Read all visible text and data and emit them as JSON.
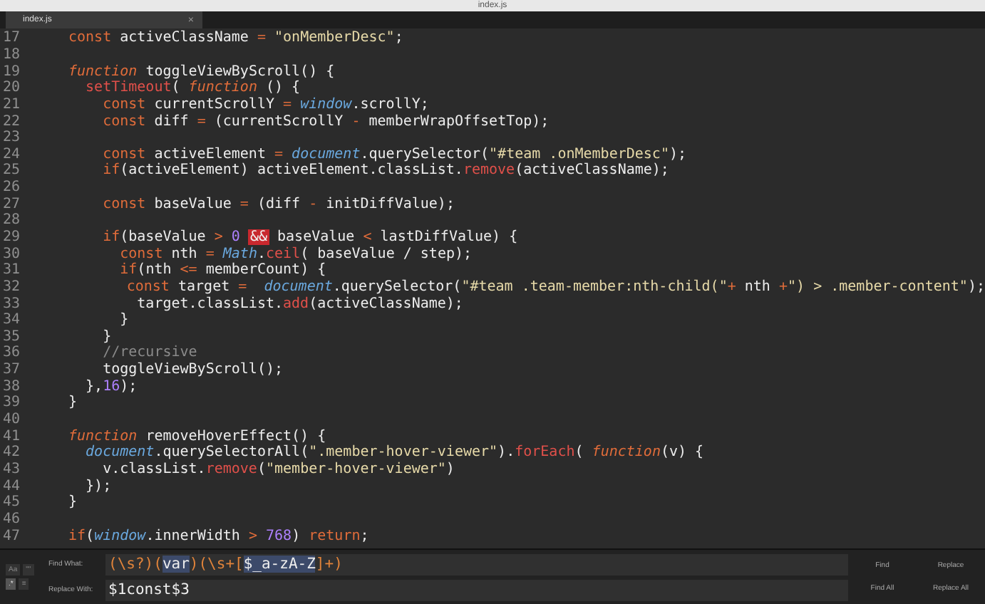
{
  "window": {
    "title": "index.js"
  },
  "tabs": [
    {
      "label": "index.js",
      "close": "×",
      "selected": true
    }
  ],
  "lines": [
    {
      "number": "17",
      "tokens": [
        {
          "kind": "kw",
          "text": "const"
        },
        {
          "kind": "p",
          "text": " activeClassName "
        },
        {
          "kind": "op",
          "text": "="
        },
        {
          "kind": "s",
          "text": " \"onMemberDesc\""
        },
        {
          "kind": "p",
          "text": ";"
        }
      ]
    },
    {
      "number": "18"
    },
    {
      "number": "19",
      "tokens": [
        {
          "kind": "fn",
          "text": "function"
        },
        {
          "kind": "p",
          "text": " toggleViewByScroll() {"
        }
      ]
    },
    {
      "number": "20",
      "tokens": [
        {
          "kind": "m",
          "text": "  setTimeout"
        },
        {
          "kind": "p",
          "text": "( "
        },
        {
          "kind": "fn",
          "text": "function"
        },
        {
          "kind": "p",
          "text": " () {"
        }
      ]
    },
    {
      "number": "21",
      "tokens": [
        {
          "kind": "kw",
          "text": "    const"
        },
        {
          "kind": "p",
          "text": " currentScrollY "
        },
        {
          "kind": "op",
          "text": "="
        },
        {
          "kind": "b",
          "text": " window"
        },
        {
          "kind": "p",
          "text": ".scrollY;"
        }
      ]
    },
    {
      "number": "22",
      "tokens": [
        {
          "kind": "kw",
          "text": "    const"
        },
        {
          "kind": "p",
          "text": " diff "
        },
        {
          "kind": "op",
          "text": "="
        },
        {
          "kind": "p",
          "text": " (currentScrollY "
        },
        {
          "kind": "op",
          "text": "-"
        },
        {
          "kind": "p",
          "text": " memberWrapOffsetTop);"
        }
      ]
    },
    {
      "number": "23"
    },
    {
      "number": "24",
      "tokens": [
        {
          "kind": "kw",
          "text": "    const"
        },
        {
          "kind": "p",
          "text": " activeElement "
        },
        {
          "kind": "op",
          "text": "="
        },
        {
          "kind": "b",
          "text": " document"
        },
        {
          "kind": "p",
          "text": ".querySelector("
        },
        {
          "kind": "s",
          "text": "\"#team .onMemberDesc\""
        },
        {
          "kind": "p",
          "text": ");"
        }
      ]
    },
    {
      "number": "25",
      "tokens": [
        {
          "kind": "kw",
          "text": "    if"
        },
        {
          "kind": "p",
          "text": "(activeElement) activeElement.classList."
        },
        {
          "kind": "m",
          "text": "remove"
        },
        {
          "kind": "p",
          "text": "(activeClassName);"
        }
      ]
    },
    {
      "number": "26"
    },
    {
      "number": "27",
      "tokens": [
        {
          "kind": "kw",
          "text": "    const"
        },
        {
          "kind": "p",
          "text": " baseValue "
        },
        {
          "kind": "op",
          "text": "="
        },
        {
          "kind": "p",
          "text": " (diff "
        },
        {
          "kind": "op",
          "text": "-"
        },
        {
          "kind": "p",
          "text": " initDiffValue);"
        }
      ]
    },
    {
      "number": "28"
    },
    {
      "number": "29",
      "tokens": [
        {
          "kind": "kw",
          "text": "    if"
        },
        {
          "kind": "p",
          "text": "(baseValue "
        },
        {
          "kind": "op",
          "text": ">"
        },
        {
          "kind": "n",
          "text": " 0 "
        },
        {
          "kind": "hl",
          "text": "&&"
        },
        {
          "kind": "p",
          "text": " baseValue "
        },
        {
          "kind": "op",
          "text": "<"
        },
        {
          "kind": "p",
          "text": " lastDiffValue) {"
        }
      ]
    },
    {
      "number": "30",
      "tokens": [
        {
          "kind": "kw",
          "text": "      const"
        },
        {
          "kind": "p",
          "text": " nth "
        },
        {
          "kind": "op",
          "text": "="
        },
        {
          "kind": "b",
          "text": " Math"
        },
        {
          "kind": "p",
          "text": "."
        },
        {
          "kind": "m",
          "text": "ceil"
        },
        {
          "kind": "p",
          "text": "( baseValue / step);"
        }
      ]
    },
    {
      "number": "31",
      "tokens": [
        {
          "kind": "kw",
          "text": "      if"
        },
        {
          "kind": "p",
          "text": "(nth "
        },
        {
          "kind": "op",
          "text": "<="
        },
        {
          "kind": "p",
          "text": " memberCount) {"
        }
      ]
    },
    {
      "number": "32",
      "tokens": [
        {
          "kind": "kw",
          "text": "        const"
        },
        {
          "kind": "p",
          "text": " target "
        },
        {
          "kind": "op",
          "text": "="
        },
        {
          "kind": "b",
          "text": "  document"
        },
        {
          "kind": "p",
          "text": ".querySelector("
        },
        {
          "kind": "s",
          "text": "\"#team .team-member:nth-child(\""
        },
        {
          "kind": "op",
          "text": "+"
        },
        {
          "kind": "p",
          "text": " nth "
        },
        {
          "kind": "op",
          "text": "+"
        },
        {
          "kind": "s",
          "text": "\") > .member-content\""
        },
        {
          "kind": "p",
          "text": ");"
        }
      ]
    },
    {
      "number": "33",
      "tokens": [
        {
          "kind": "p",
          "text": "        target.classList."
        },
        {
          "kind": "m",
          "text": "add"
        },
        {
          "kind": "p",
          "text": "(activeClassName);"
        }
      ]
    },
    {
      "number": "34",
      "tokens": [
        {
          "kind": "p",
          "text": "      }"
        }
      ]
    },
    {
      "number": "35",
      "tokens": [
        {
          "kind": "p",
          "text": "    }"
        }
      ]
    },
    {
      "number": "36",
      "tokens": [
        {
          "kind": "c",
          "text": "    //recursive"
        }
      ]
    },
    {
      "number": "37",
      "tokens": [
        {
          "kind": "p",
          "text": "    toggleViewByScroll();"
        }
      ]
    },
    {
      "number": "38",
      "tokens": [
        {
          "kind": "p",
          "text": "  },"
        },
        {
          "kind": "n",
          "text": "16"
        },
        {
          "kind": "p",
          "text": ");"
        }
      ]
    },
    {
      "number": "39",
      "tokens": [
        {
          "kind": "p",
          "text": "}"
        }
      ]
    },
    {
      "number": "40"
    },
    {
      "number": "41",
      "tokens": [
        {
          "kind": "fn",
          "text": "function"
        },
        {
          "kind": "p",
          "text": " removeHoverEffect() {"
        }
      ]
    },
    {
      "number": "42",
      "tokens": [
        {
          "kind": "b",
          "text": "  document"
        },
        {
          "kind": "p",
          "text": ".querySelectorAll("
        },
        {
          "kind": "s",
          "text": "\".member-hover-viewer\""
        },
        {
          "kind": "p",
          "text": ")."
        },
        {
          "kind": "m",
          "text": "forEach"
        },
        {
          "kind": "p",
          "text": "( "
        },
        {
          "kind": "fn",
          "text": "function"
        },
        {
          "kind": "p",
          "text": "(v) {"
        }
      ]
    },
    {
      "number": "43",
      "tokens": [
        {
          "kind": "p",
          "text": "    v.classList."
        },
        {
          "kind": "m",
          "text": "remove"
        },
        {
          "kind": "p",
          "text": "("
        },
        {
          "kind": "s",
          "text": "\"member-hover-viewer\""
        },
        {
          "kind": "p",
          "text": ")"
        }
      ]
    },
    {
      "number": "44",
      "tokens": [
        {
          "kind": "p",
          "text": "  });"
        }
      ]
    },
    {
      "number": "45",
      "tokens": [
        {
          "kind": "p",
          "text": "}"
        }
      ]
    },
    {
      "number": "46"
    },
    {
      "number": "47",
      "tokens": [
        {
          "kind": "kw",
          "text": "if"
        },
        {
          "kind": "p",
          "text": "("
        },
        {
          "kind": "b",
          "text": "window"
        },
        {
          "kind": "p",
          "text": ".innerWidth "
        },
        {
          "kind": "op",
          "text": ">"
        },
        {
          "kind": "n",
          "text": " 768"
        },
        {
          "kind": "p",
          "text": ") "
        },
        {
          "kind": "kw",
          "text": "return"
        },
        {
          "kind": "p",
          "text": ";"
        }
      ]
    }
  ],
  "find_panel": {
    "find_label": "Find What:",
    "find_tokens": [
      {
        "kind": "op",
        "text": "(\\s?)("
      },
      {
        "kind": "p",
        "text": "var"
      },
      {
        "kind": "op",
        "text": ")(\\s+["
      },
      {
        "kind": "p",
        "text": "$_a-zA-Z"
      },
      {
        "kind": "op",
        "text": "]+)"
      }
    ],
    "replace_label": "Replace With:",
    "replace_value": "$1const$3",
    "options": [
      {
        "label": "Aa",
        "on": false
      },
      {
        "label": "\"\"",
        "on": false
      },
      {
        "label": ".*",
        "on": true
      },
      {
        "label": "≡",
        "on": false
      }
    ],
    "buttons": [
      "Find",
      "Replace",
      "Find All",
      "Replace All"
    ]
  }
}
